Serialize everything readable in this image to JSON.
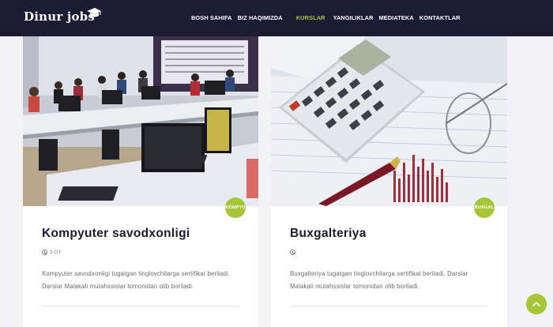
{
  "header": {
    "logo_text": "Dinur jobs",
    "nav": [
      {
        "label": "BOSH SAHIFA"
      },
      {
        "label": "BIZ HAQIMIZDA"
      },
      {
        "label": "KURSLAR",
        "active": true
      },
      {
        "label": "YANGILIKLAR"
      },
      {
        "label": "MEDIATEKA"
      },
      {
        "label": "KONTAKTLAR"
      }
    ]
  },
  "courses": [
    {
      "badge": "KOMPYU",
      "title": "Kompyuter savodxonligi",
      "duration": "3 OY",
      "description": "Kompyuter savodxonligi tugatgan tinglovchilarga sertifikat beriladi. Darslar Malakali mutahssislar tomonidan olib boriladi.",
      "image": "classroom-with-computers-photo"
    },
    {
      "badge": "BUXGAL",
      "title": "Buxgalteriya",
      "duration": "",
      "description": "Buxgalteriya tugatgan tinglovchilarga sertifikat beriladi. Darslar Malakali mutahssislar tomonidan olib boriladi.",
      "image": "calculator-and-pen-photo"
    }
  ],
  "icons": {
    "clock": "clock-icon",
    "scroll_top": "chevron-up-icon"
  },
  "colors": {
    "navbar": "#1d1b31",
    "accent": "#a4c639",
    "title": "#1d1b31",
    "text": "#6b6b6b"
  }
}
